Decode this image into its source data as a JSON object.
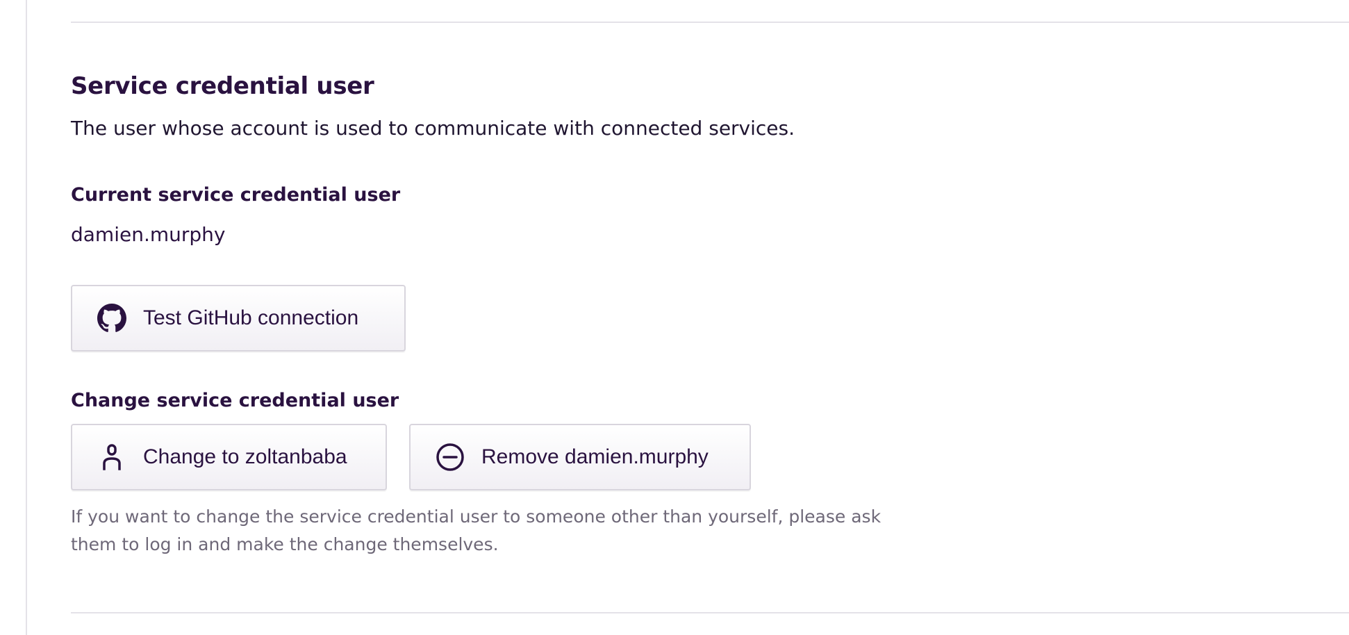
{
  "section": {
    "title": "Service credential user",
    "description": "The user whose account is used to communicate with connected services."
  },
  "current": {
    "label": "Current service credential user",
    "value": "damien.murphy"
  },
  "buttons": {
    "test_github": {
      "label": "Test GitHub connection",
      "icon": "github-icon"
    },
    "change_to": {
      "label": "Change to zoltanbaba",
      "icon": "user-icon"
    },
    "remove": {
      "label": "Remove damien.murphy",
      "icon": "minus-circle-icon"
    }
  },
  "change": {
    "label": "Change service credential user",
    "hint": "If you want to change the service credential user to someone other than yourself, please ask them to log in and make the change themselves."
  },
  "colors": {
    "heading": "#2a1240",
    "muted": "#6e6878",
    "divider": "#e4e2e8",
    "button_border": "#d8d5dd"
  }
}
